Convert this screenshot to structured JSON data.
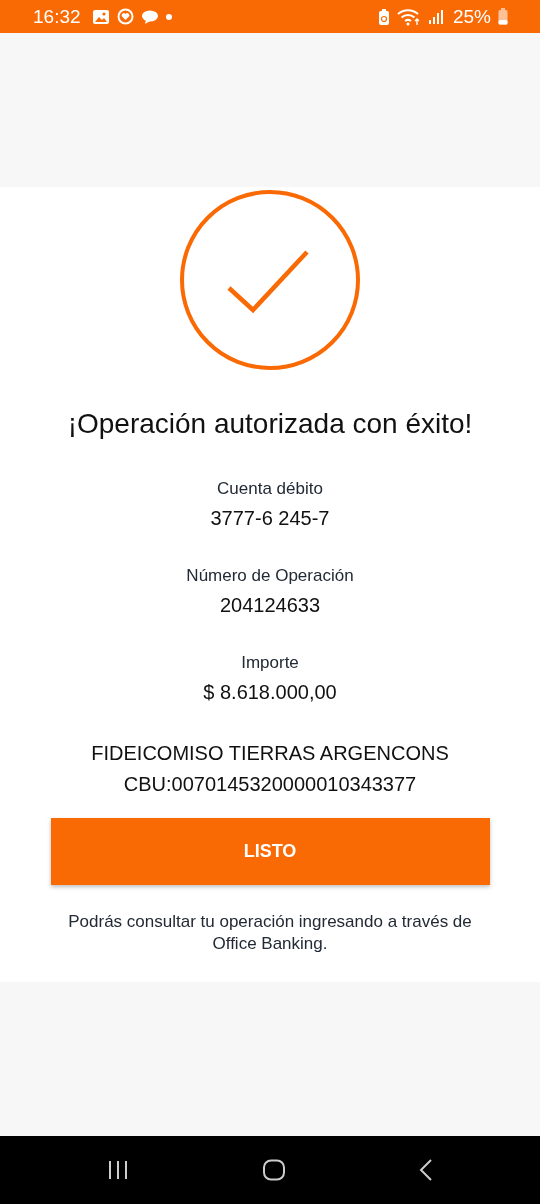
{
  "status_bar": {
    "time": "16:32",
    "battery": "25%"
  },
  "title": "¡Operación autorizada con éxito!",
  "details": [
    {
      "label": "Cuenta débito",
      "value": "3777-6 245-7"
    },
    {
      "label": "Número de Operación",
      "value": "204124633"
    },
    {
      "label": "Importe",
      "value": "$ 8.618.000,00"
    }
  ],
  "recipient": {
    "name": "FIDEICOMISO TIERRAS ARGENCONS",
    "cbu": "CBU:0070145320000010343377"
  },
  "button": "LISTO",
  "note": "Podrás consultar tu operación ingresando a través de Office Banking."
}
